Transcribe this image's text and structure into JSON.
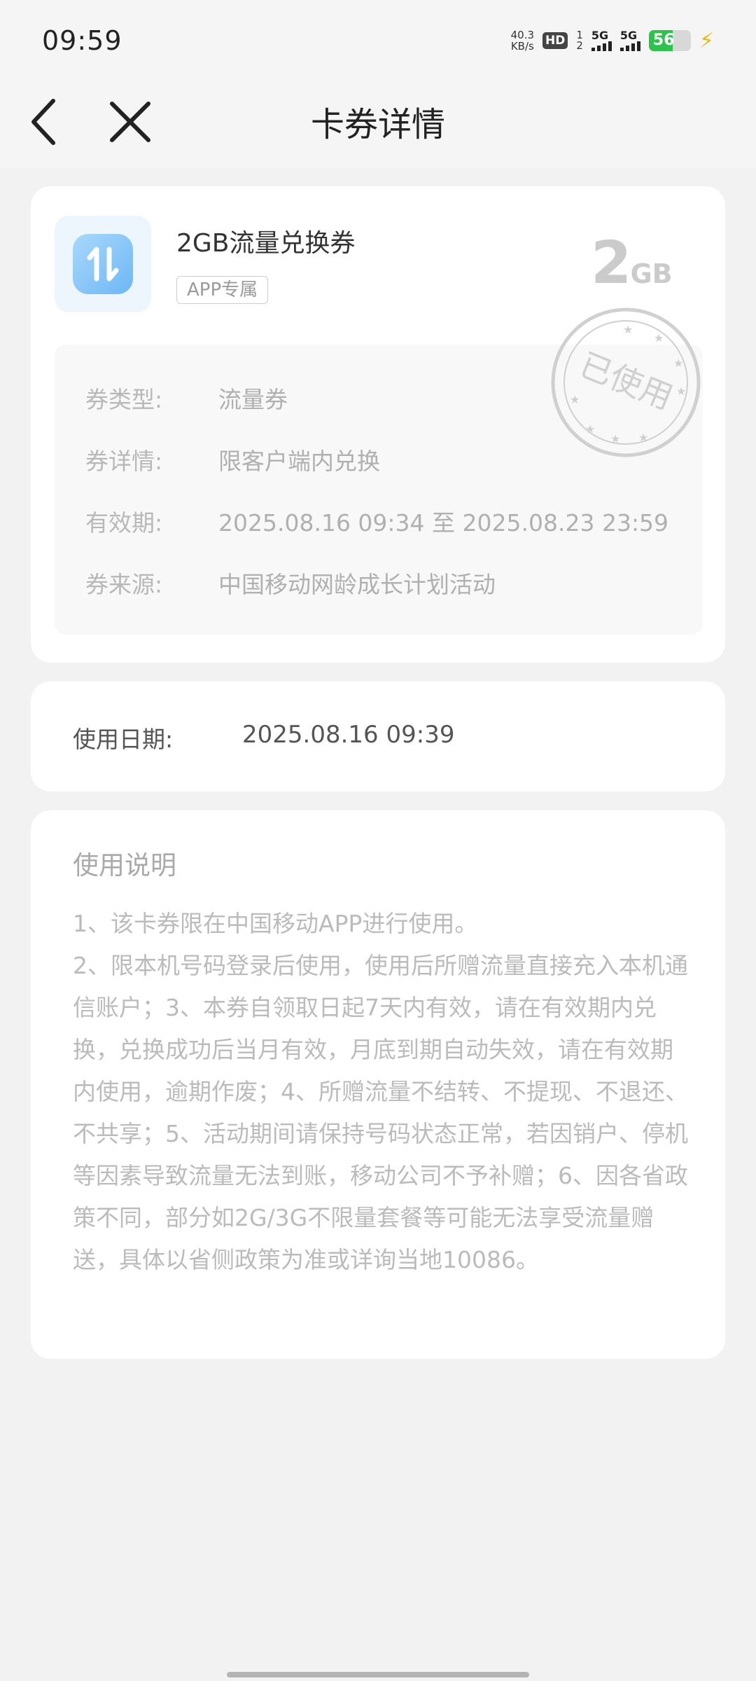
{
  "status_bar": {
    "time": "09:59",
    "net_speed_value": "40.3",
    "net_speed_unit": "KB/s",
    "hd_label": "HD",
    "sim_label": "1\n2",
    "signal1_label": "5G",
    "signal2_label": "5G",
    "battery_percent": "56",
    "battery_level": 0.56,
    "charging_icon": "lightning-bolt-icon"
  },
  "header": {
    "title": "卡券详情",
    "back_icon": "back-arrow-icon",
    "close_icon": "close-icon"
  },
  "coupon": {
    "name": "2GB流量兑换券",
    "tag": "APP专属",
    "amount_number": "2",
    "amount_unit": "GB",
    "icon": "data-transfer-icon",
    "stamp_text": "已使用",
    "details": [
      {
        "label": "券类型:",
        "value": "流量券"
      },
      {
        "label": "券详情:",
        "value": "限客户端内兑换"
      },
      {
        "label": "有效期:",
        "value": "2025.08.16 09:34 至 2025.08.23 23:59"
      },
      {
        "label": "券来源:",
        "value": "中国移动网龄成长计划活动"
      }
    ]
  },
  "usage": {
    "label": "使用日期:",
    "value": "2025.08.16 09:39"
  },
  "instructions": {
    "title": "使用说明",
    "line1": "1、该卡券限在中国移动APP进行使用。",
    "line2": "2、限本机号码登录后使用，使用后所赠流量直接充入本机通信账户；3、本券自领取日起7天内有效，请在有效期内兑换，兑换成功后当月有效，月底到期自动失效，请在有效期内使用，逾期作废；4、所赠流量不结转、不提现、不退还、不共享；5、活动期间请保持号码状态正常，若因销户、停机等因素导致流量无法到账，移动公司不予补赠；6、因各省政策不同，部分如2G/3G不限量套餐等可能无法享受流量赠送，具体以省侧政策为准或详询当地10086。"
  },
  "colors": {
    "page_bg": "#f2f2f2",
    "card_bg": "#ffffff",
    "icon_blue": "#7cc0f8",
    "battery_green": "#2ec14d",
    "stamp_gray": "#d0d0d0"
  }
}
